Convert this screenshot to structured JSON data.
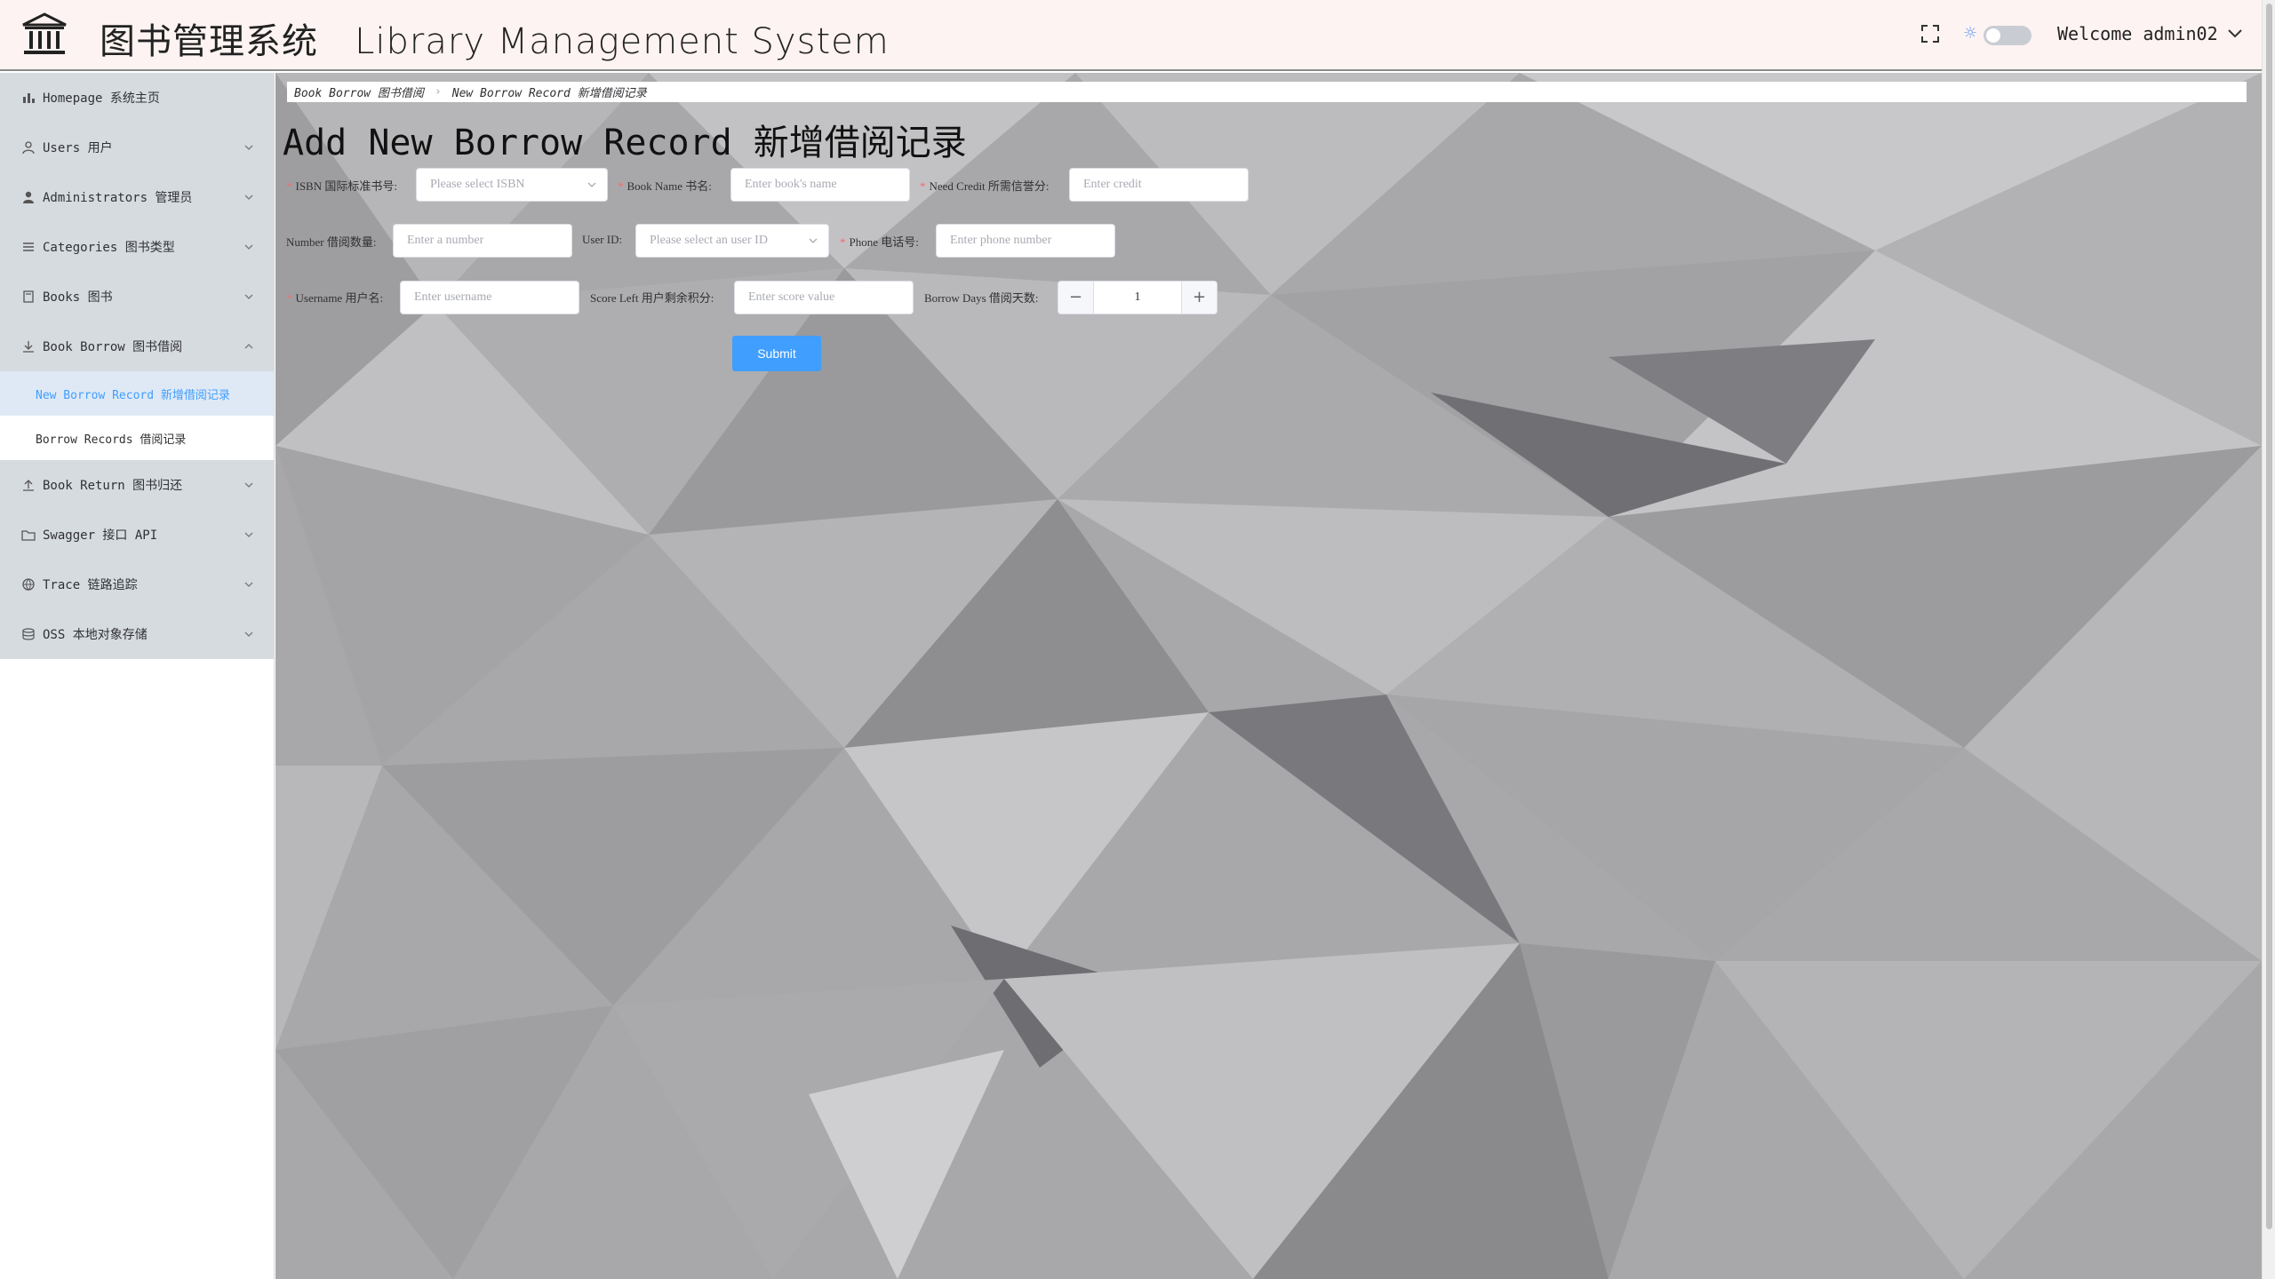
{
  "header": {
    "title": "图书管理系统   Library Management System",
    "logo_icon": "bank-icon",
    "fullscreen_icon": "fullscreen-icon",
    "theme_icon": "sun-icon",
    "theme_dark_mode": false,
    "welcome": "Welcome admin02"
  },
  "sidebar": {
    "items": [
      {
        "label": "Homepage 系统主页",
        "icon": "bar-chart-icon"
      },
      {
        "label": "Users 用户",
        "icon": "user-icon"
      },
      {
        "label": "Administrators 管理员",
        "icon": "admin-icon"
      },
      {
        "label": "Categories 图书类型",
        "icon": "list-icon"
      },
      {
        "label": "Books 图书",
        "icon": "book-icon"
      },
      {
        "label": "Book Borrow 图书借阅",
        "icon": "download-icon",
        "expanded": true
      },
      {
        "label": "Book Return 图书归还",
        "icon": "upload-icon"
      },
      {
        "label": "Swagger 接口 API",
        "icon": "folder-icon"
      },
      {
        "label": "Trace 链路追踪",
        "icon": "globe-icon"
      },
      {
        "label": "OSS 本地对象存储",
        "icon": "database-icon"
      }
    ],
    "borrow_sub": [
      {
        "label": "New Borrow Record 新增借阅记录",
        "active": true
      },
      {
        "label": "Borrow Records 借阅记录",
        "active": false
      }
    ]
  },
  "breadcrumb": {
    "parent": "Book Borrow 图书借阅",
    "current": "New Borrow Record 新增借阅记录"
  },
  "page_title": "Add New Borrow Record 新增借阅记录",
  "form": {
    "isbn": {
      "label": "ISBN 国际标准书号:",
      "placeholder": "Please select ISBN"
    },
    "book_name": {
      "label": "Book Name 书名:",
      "placeholder": "Enter book's name"
    },
    "need_credit": {
      "label": "Need Credit 所需信誉分:",
      "placeholder": "Enter credit"
    },
    "number": {
      "label": "Number 借阅数量:",
      "placeholder": "Enter a number"
    },
    "user_id": {
      "label": "User ID:",
      "placeholder": "Please select an user ID"
    },
    "phone": {
      "label": "Phone 电话号:",
      "placeholder": "Enter phone number"
    },
    "username": {
      "label": "Username 用户名:",
      "placeholder": "Enter username"
    },
    "score_left": {
      "label": "Score Left 用户剩余积分:",
      "placeholder": "Enter score value"
    },
    "borrow_days": {
      "label": "Borrow Days 借阅天数:",
      "value": "1",
      "minus": "−",
      "plus": "+"
    },
    "submit": "Submit"
  },
  "colors": {
    "accent": "#409eff",
    "required": "#f56c6c",
    "header_bg": "#fdf3f2",
    "menu_bg": "#d6dbe0"
  }
}
